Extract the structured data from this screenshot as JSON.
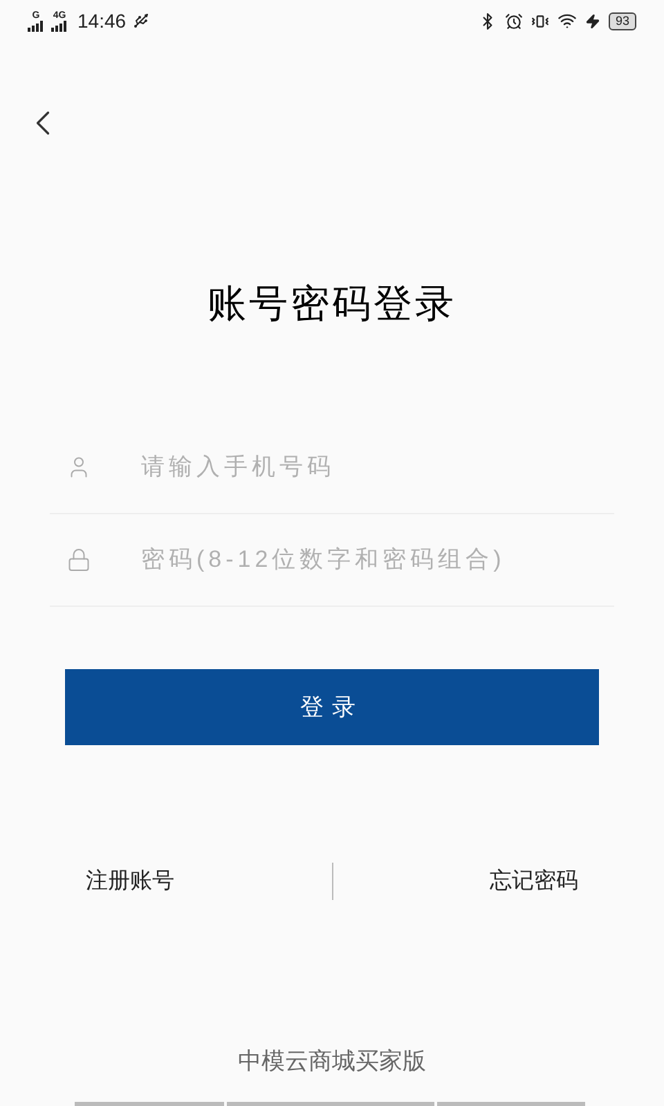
{
  "status_bar": {
    "networks": [
      "G",
      "4G"
    ],
    "time": "14:46",
    "battery": "93"
  },
  "title": "账号密码登录",
  "fields": [
    {
      "kind": "phone",
      "placeholder": "请输入手机号码"
    },
    {
      "kind": "password",
      "placeholder": "密码(8-12位数字和密码组合)"
    }
  ],
  "login_button": "登录",
  "links": [
    "注册账号",
    "忘记密码"
  ],
  "footer": "中模云商城买家版"
}
